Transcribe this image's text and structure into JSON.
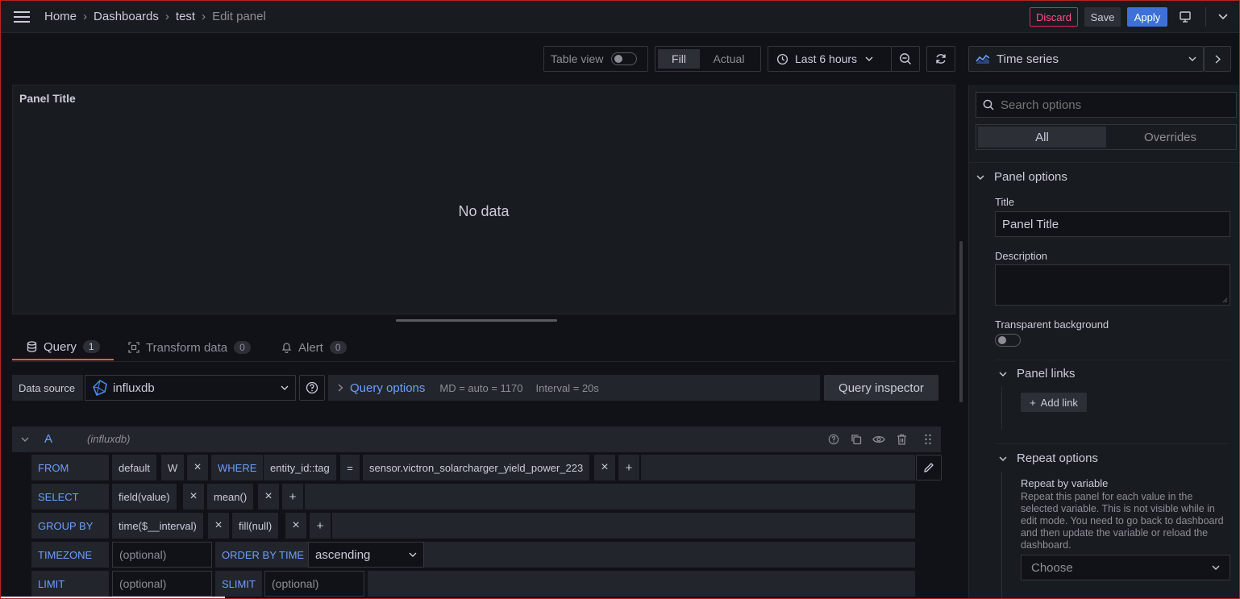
{
  "topbar": {
    "breadcrumb": [
      "Home",
      "Dashboards",
      "test",
      "Edit panel"
    ],
    "discard": "Discard",
    "save": "Save",
    "apply": "Apply"
  },
  "toolbar": {
    "table_view": "Table view",
    "fill": "Fill",
    "actual": "Actual",
    "time_range": "Last 6 hours",
    "viz_type": "Time series"
  },
  "panel": {
    "title": "Panel Title",
    "no_data": "No data"
  },
  "tabs": [
    {
      "label": "Query",
      "count": "1"
    },
    {
      "label": "Transform data",
      "count": "0"
    },
    {
      "label": "Alert",
      "count": "0"
    }
  ],
  "datasource": {
    "label": "Data source",
    "name": "influxdb",
    "query_options": "Query options",
    "md": "MD = auto = 1170",
    "interval": "Interval = 20s",
    "inspector": "Query inspector"
  },
  "query": {
    "ref": "A",
    "ds": "(influxdb)",
    "from_kw": "FROM",
    "from_policy": "default",
    "from_measurement": "W",
    "where_kw": "WHERE",
    "where_tag": "entity_id::tag",
    "where_op": "=",
    "where_value": "sensor.victron_solarcharger_yield_power_223",
    "select_kw": "SELECT",
    "select_field": "field(value)",
    "select_fn": "mean()",
    "groupby_kw": "GROUP BY",
    "groupby_time": "time($__interval)",
    "groupby_fill": "fill(null)",
    "timezone_kw": "TIMEZONE",
    "optional": "(optional)",
    "orderby_kw": "ORDER BY TIME",
    "orderby_value": "ascending",
    "limit_kw": "LIMIT",
    "slimit_kw": "SLIMIT",
    "plus": "+",
    "times": "×"
  },
  "options": {
    "search_placeholder": "Search options",
    "all": "All",
    "overrides": "Overrides",
    "panel_options": "Panel options",
    "title_label": "Title",
    "title_value": "Panel Title",
    "description_label": "Description",
    "transparent_label": "Transparent background",
    "panel_links": "Panel links",
    "add_link": "Add link",
    "repeat_options": "Repeat options",
    "repeat_label": "Repeat by variable",
    "repeat_desc": "Repeat this panel for each value in the selected variable. This is not visible while in edit mode. You need to go back to dashboard and then update the variable or reload the dashboard.",
    "choose": "Choose"
  },
  "colors": {
    "accent": "#3d71d9",
    "discard": "#e0226e",
    "tab_underline": "#f55f3e"
  }
}
